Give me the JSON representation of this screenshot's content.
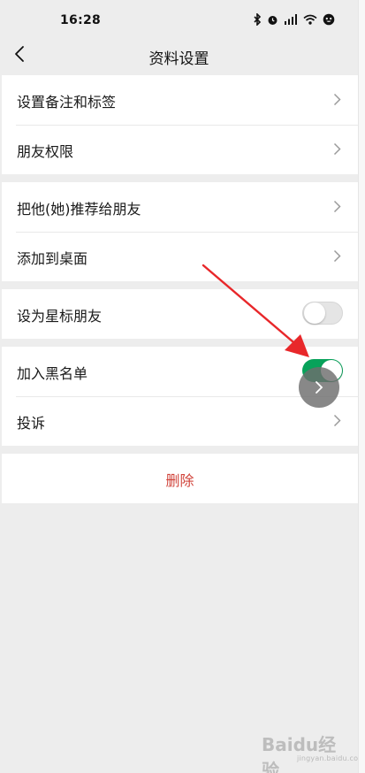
{
  "status_bar": {
    "time": "16:28"
  },
  "nav": {
    "title": "资料设置"
  },
  "groups": [
    {
      "items": [
        {
          "label": "设置备注和标签"
        },
        {
          "label": "朋友权限"
        }
      ]
    },
    {
      "items": [
        {
          "label": "把他(她)推荐给朋友"
        },
        {
          "label": "添加到桌面"
        }
      ]
    },
    {
      "items": [
        {
          "label": "设为星标朋友",
          "toggle": "off"
        }
      ]
    },
    {
      "items": [
        {
          "label": "加入黑名单",
          "toggle": "on"
        },
        {
          "label": "投诉"
        }
      ]
    }
  ],
  "delete": {
    "label": "删除",
    "color": "#d0433a"
  },
  "colors": {
    "toggle_on": "#07a25a",
    "annotation_arrow": "#e8272a"
  },
  "icons": {
    "back": "chevron-left-icon",
    "row": "chevron-right-icon"
  },
  "watermark": {
    "brand": "Baidu经验",
    "url": "jingyan.baidu.com"
  }
}
